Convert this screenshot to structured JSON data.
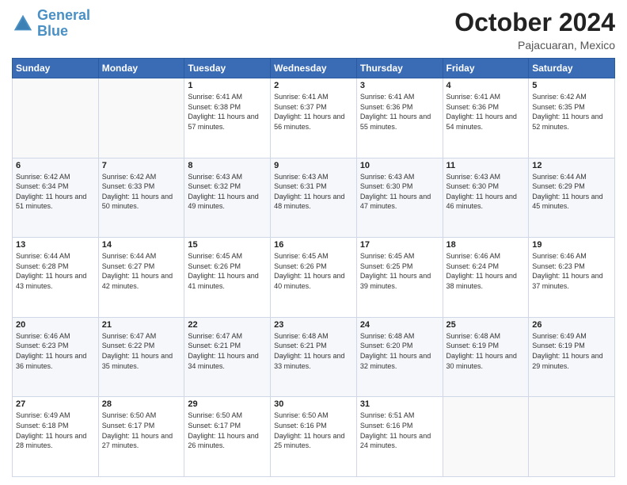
{
  "logo": {
    "line1": "General",
    "line2": "Blue"
  },
  "header": {
    "month": "October 2024",
    "location": "Pajacuaran, Mexico"
  },
  "weekdays": [
    "Sunday",
    "Monday",
    "Tuesday",
    "Wednesday",
    "Thursday",
    "Friday",
    "Saturday"
  ],
  "weeks": [
    [
      {
        "day": "",
        "sunrise": "",
        "sunset": "",
        "daylight": ""
      },
      {
        "day": "",
        "sunrise": "",
        "sunset": "",
        "daylight": ""
      },
      {
        "day": "1",
        "sunrise": "Sunrise: 6:41 AM",
        "sunset": "Sunset: 6:38 PM",
        "daylight": "Daylight: 11 hours and 57 minutes."
      },
      {
        "day": "2",
        "sunrise": "Sunrise: 6:41 AM",
        "sunset": "Sunset: 6:37 PM",
        "daylight": "Daylight: 11 hours and 56 minutes."
      },
      {
        "day": "3",
        "sunrise": "Sunrise: 6:41 AM",
        "sunset": "Sunset: 6:36 PM",
        "daylight": "Daylight: 11 hours and 55 minutes."
      },
      {
        "day": "4",
        "sunrise": "Sunrise: 6:41 AM",
        "sunset": "Sunset: 6:36 PM",
        "daylight": "Daylight: 11 hours and 54 minutes."
      },
      {
        "day": "5",
        "sunrise": "Sunrise: 6:42 AM",
        "sunset": "Sunset: 6:35 PM",
        "daylight": "Daylight: 11 hours and 52 minutes."
      }
    ],
    [
      {
        "day": "6",
        "sunrise": "Sunrise: 6:42 AM",
        "sunset": "Sunset: 6:34 PM",
        "daylight": "Daylight: 11 hours and 51 minutes."
      },
      {
        "day": "7",
        "sunrise": "Sunrise: 6:42 AM",
        "sunset": "Sunset: 6:33 PM",
        "daylight": "Daylight: 11 hours and 50 minutes."
      },
      {
        "day": "8",
        "sunrise": "Sunrise: 6:43 AM",
        "sunset": "Sunset: 6:32 PM",
        "daylight": "Daylight: 11 hours and 49 minutes."
      },
      {
        "day": "9",
        "sunrise": "Sunrise: 6:43 AM",
        "sunset": "Sunset: 6:31 PM",
        "daylight": "Daylight: 11 hours and 48 minutes."
      },
      {
        "day": "10",
        "sunrise": "Sunrise: 6:43 AM",
        "sunset": "Sunset: 6:30 PM",
        "daylight": "Daylight: 11 hours and 47 minutes."
      },
      {
        "day": "11",
        "sunrise": "Sunrise: 6:43 AM",
        "sunset": "Sunset: 6:30 PM",
        "daylight": "Daylight: 11 hours and 46 minutes."
      },
      {
        "day": "12",
        "sunrise": "Sunrise: 6:44 AM",
        "sunset": "Sunset: 6:29 PM",
        "daylight": "Daylight: 11 hours and 45 minutes."
      }
    ],
    [
      {
        "day": "13",
        "sunrise": "Sunrise: 6:44 AM",
        "sunset": "Sunset: 6:28 PM",
        "daylight": "Daylight: 11 hours and 43 minutes."
      },
      {
        "day": "14",
        "sunrise": "Sunrise: 6:44 AM",
        "sunset": "Sunset: 6:27 PM",
        "daylight": "Daylight: 11 hours and 42 minutes."
      },
      {
        "day": "15",
        "sunrise": "Sunrise: 6:45 AM",
        "sunset": "Sunset: 6:26 PM",
        "daylight": "Daylight: 11 hours and 41 minutes."
      },
      {
        "day": "16",
        "sunrise": "Sunrise: 6:45 AM",
        "sunset": "Sunset: 6:26 PM",
        "daylight": "Daylight: 11 hours and 40 minutes."
      },
      {
        "day": "17",
        "sunrise": "Sunrise: 6:45 AM",
        "sunset": "Sunset: 6:25 PM",
        "daylight": "Daylight: 11 hours and 39 minutes."
      },
      {
        "day": "18",
        "sunrise": "Sunrise: 6:46 AM",
        "sunset": "Sunset: 6:24 PM",
        "daylight": "Daylight: 11 hours and 38 minutes."
      },
      {
        "day": "19",
        "sunrise": "Sunrise: 6:46 AM",
        "sunset": "Sunset: 6:23 PM",
        "daylight": "Daylight: 11 hours and 37 minutes."
      }
    ],
    [
      {
        "day": "20",
        "sunrise": "Sunrise: 6:46 AM",
        "sunset": "Sunset: 6:23 PM",
        "daylight": "Daylight: 11 hours and 36 minutes."
      },
      {
        "day": "21",
        "sunrise": "Sunrise: 6:47 AM",
        "sunset": "Sunset: 6:22 PM",
        "daylight": "Daylight: 11 hours and 35 minutes."
      },
      {
        "day": "22",
        "sunrise": "Sunrise: 6:47 AM",
        "sunset": "Sunset: 6:21 PM",
        "daylight": "Daylight: 11 hours and 34 minutes."
      },
      {
        "day": "23",
        "sunrise": "Sunrise: 6:48 AM",
        "sunset": "Sunset: 6:21 PM",
        "daylight": "Daylight: 11 hours and 33 minutes."
      },
      {
        "day": "24",
        "sunrise": "Sunrise: 6:48 AM",
        "sunset": "Sunset: 6:20 PM",
        "daylight": "Daylight: 11 hours and 32 minutes."
      },
      {
        "day": "25",
        "sunrise": "Sunrise: 6:48 AM",
        "sunset": "Sunset: 6:19 PM",
        "daylight": "Daylight: 11 hours and 30 minutes."
      },
      {
        "day": "26",
        "sunrise": "Sunrise: 6:49 AM",
        "sunset": "Sunset: 6:19 PM",
        "daylight": "Daylight: 11 hours and 29 minutes."
      }
    ],
    [
      {
        "day": "27",
        "sunrise": "Sunrise: 6:49 AM",
        "sunset": "Sunset: 6:18 PM",
        "daylight": "Daylight: 11 hours and 28 minutes."
      },
      {
        "day": "28",
        "sunrise": "Sunrise: 6:50 AM",
        "sunset": "Sunset: 6:17 PM",
        "daylight": "Daylight: 11 hours and 27 minutes."
      },
      {
        "day": "29",
        "sunrise": "Sunrise: 6:50 AM",
        "sunset": "Sunset: 6:17 PM",
        "daylight": "Daylight: 11 hours and 26 minutes."
      },
      {
        "day": "30",
        "sunrise": "Sunrise: 6:50 AM",
        "sunset": "Sunset: 6:16 PM",
        "daylight": "Daylight: 11 hours and 25 minutes."
      },
      {
        "day": "31",
        "sunrise": "Sunrise: 6:51 AM",
        "sunset": "Sunset: 6:16 PM",
        "daylight": "Daylight: 11 hours and 24 minutes."
      },
      {
        "day": "",
        "sunrise": "",
        "sunset": "",
        "daylight": ""
      },
      {
        "day": "",
        "sunrise": "",
        "sunset": "",
        "daylight": ""
      }
    ]
  ]
}
